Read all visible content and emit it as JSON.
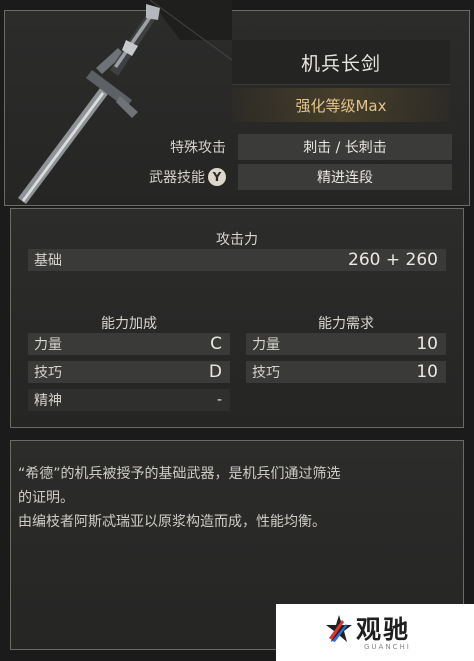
{
  "weapon": {
    "name": "机兵长剑",
    "upgrade": "强化等级Max",
    "image_icon": "longsword-icon"
  },
  "attributes": [
    {
      "label": "特殊攻击",
      "value": "刺击 / 长刺击"
    },
    {
      "label": "武器技能",
      "button_glyph": "Y",
      "value": "精进连段"
    }
  ],
  "attack": {
    "title": "攻击力",
    "base_label": "基础",
    "base_value": "260 + 260"
  },
  "scaling": {
    "title": "能力加成",
    "rows": [
      {
        "label": "力量",
        "value": "C"
      },
      {
        "label": "技巧",
        "value": "D"
      },
      {
        "label": "精神",
        "value": "-"
      }
    ]
  },
  "requirements": {
    "title": "能力需求",
    "rows": [
      {
        "label": "力量",
        "value": "10"
      },
      {
        "label": "技巧",
        "value": "10"
      }
    ]
  },
  "description": {
    "line1": "“希德”的机兵被授予的基础武器，是机兵们通过筛选",
    "line2": "的证明。",
    "line3": "由编枝者阿斯忒瑞亚以原浆构造而成，性能均衡。"
  },
  "watermark": {
    "brand": "观驰",
    "sub": "GUANCHI"
  }
}
